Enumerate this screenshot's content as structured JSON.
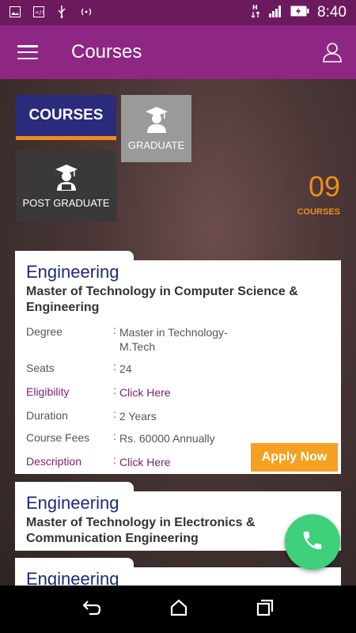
{
  "status_bar": {
    "time": "8:40"
  },
  "toolbar": {
    "title": "Courses"
  },
  "tiles": {
    "courses": "COURSES",
    "graduate": "GRADUATE",
    "post_graduate": "POST GRADUATE"
  },
  "count": {
    "number": "09",
    "label": "COURSES"
  },
  "cards": [
    {
      "department": "Engineering",
      "title": "Master of  Technology  in Computer Science & Engineering",
      "fields": {
        "degree_label": "Degree",
        "degree_value": "Master in Technology-M.Tech",
        "seats_label": "Seats",
        "seats_value": "24",
        "eligibility_label": "Eligibility",
        "eligibility_value": "Click Here",
        "duration_label": "Duration",
        "duration_value": "2 Years",
        "fees_label": "Course Fees",
        "fees_value": "Rs. 60000 Annually",
        "description_label": "Description",
        "description_value": "Click Here"
      },
      "apply_label": "Apply Now"
    },
    {
      "department": "Engineering",
      "title": "Master of Technology in Electronics & Communication Engineering"
    },
    {
      "department": "Engineering"
    }
  ],
  "colors": {
    "toolbar": "#8e2683",
    "accent": "#f08c1a",
    "courses_tile": "#2a2b7a",
    "fab": "#3ed07a"
  }
}
